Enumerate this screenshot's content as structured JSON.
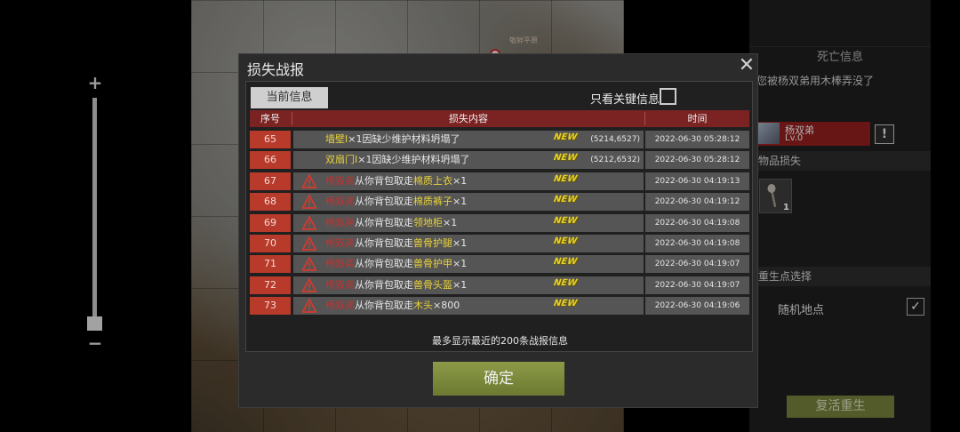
{
  "map": {
    "place_label": "敬鲜平原"
  },
  "zoom": {
    "plus": "+",
    "minus": "−"
  },
  "death_panel": {
    "title": "死亡信息",
    "message": "您被杨双弟用木棒弄没了",
    "killer": {
      "name": "杨双弟",
      "level": "Lv.0"
    },
    "warn_symbol": "!",
    "items_title": "物品损失",
    "item": {
      "icon": "wooden-club-icon",
      "count": "1"
    },
    "respawn_title": "重生点选择",
    "respawn_option": "随机地点",
    "respawn_checked": "✓",
    "revive_label": "复活重生"
  },
  "dialog": {
    "title": "损失战报",
    "close": "✕",
    "tab_current": "当前信息",
    "only_key_label": "只看关键信息",
    "columns": {
      "no": "序号",
      "content": "损失内容",
      "time": "时间"
    },
    "new_label": "NEW",
    "rows": [
      {
        "no": "65",
        "kind": "building",
        "item": "墙壁I",
        "rest": "×1因缺少维护材料坍塌了",
        "coord": "(5214,6527)",
        "time": "2022-06-30 05:28:12"
      },
      {
        "no": "66",
        "kind": "building",
        "item": "双扇门I",
        "rest": "×1因缺少维护材料坍塌了",
        "coord": "(5212,6532)",
        "time": "2022-06-30 05:28:12"
      },
      {
        "no": "67",
        "kind": "theft",
        "actor": "杨双弟",
        "mid": "从你背包取走",
        "item": "棉质上衣",
        "qty": "×1",
        "time": "2022-06-30 04:19:13"
      },
      {
        "no": "68",
        "kind": "theft",
        "actor": "杨双弟",
        "mid": "从你背包取走",
        "item": "棉质裤子",
        "qty": "×1",
        "time": "2022-06-30 04:19:12"
      },
      {
        "no": "69",
        "kind": "theft",
        "actor": "杨双弟",
        "mid": "从你背包取走",
        "item": "领地柜",
        "qty": "×1",
        "time": "2022-06-30 04:19:08"
      },
      {
        "no": "70",
        "kind": "theft",
        "actor": "杨双弟",
        "mid": "从你背包取走",
        "item": "兽骨护腿",
        "qty": "×1",
        "time": "2022-06-30 04:19:08"
      },
      {
        "no": "71",
        "kind": "theft",
        "actor": "杨双弟",
        "mid": "从你背包取走",
        "item": "兽骨护甲",
        "qty": "×1",
        "time": "2022-06-30 04:19:07"
      },
      {
        "no": "72",
        "kind": "theft",
        "actor": "杨双弟",
        "mid": "从你背包取走",
        "item": "兽骨头盔",
        "qty": "×1",
        "time": "2022-06-30 04:19:07"
      },
      {
        "no": "73",
        "kind": "theft",
        "actor": "杨双弟",
        "mid": "从你背包取走",
        "item": "木头",
        "qty": "×800",
        "time": "2022-06-30 04:19:06"
      }
    ],
    "footer_note": "最多显示最近的200条战报信息",
    "confirm_label": "确定"
  },
  "colors": {
    "header_red": "#7b2222",
    "number_red": "#b73a2a",
    "actor_red": "#c9302c",
    "item_yellow": "#e8d23a",
    "confirm_green": "#7a8a3d"
  }
}
